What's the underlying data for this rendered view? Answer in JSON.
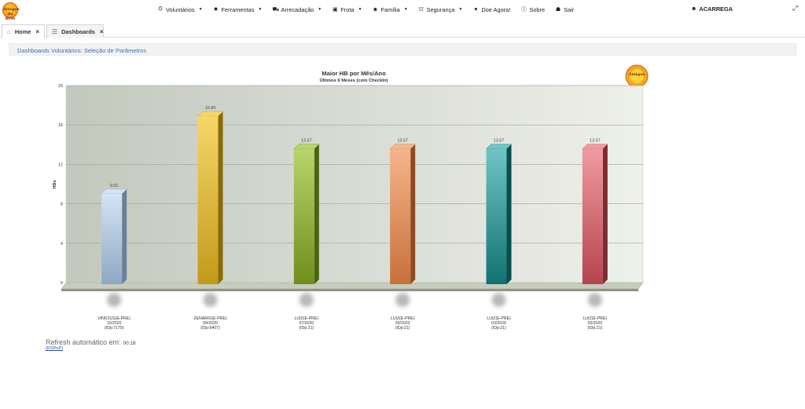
{
  "navbar": {
    "logo_text": "Amigos do Bem",
    "menu": [
      {
        "label": "Voluntários",
        "icon": "handshake-icon",
        "glyph": "⛭",
        "caret": true
      },
      {
        "label": "Ferramentas",
        "icon": "gear-icon",
        "glyph": "✹",
        "caret": true
      },
      {
        "label": "Arrecadação",
        "icon": "cart-icon",
        "glyph": "⛟",
        "caret": true
      },
      {
        "label": "Frota",
        "icon": "bus-icon",
        "glyph": "▣",
        "caret": true
      },
      {
        "label": "Família",
        "icon": "users-icon",
        "glyph": "☻",
        "caret": true
      },
      {
        "label": "Segurança",
        "icon": "lock-icon",
        "glyph": "⛫",
        "caret": true
      },
      {
        "label": "Doe Agora!",
        "icon": "heart-icon",
        "glyph": "♥",
        "caret": false
      },
      {
        "label": "Sobre",
        "icon": "info-icon",
        "glyph": "ⓘ",
        "caret": false
      },
      {
        "label": "Sair",
        "icon": "exit-icon",
        "glyph": "☗",
        "caret": false
      }
    ],
    "user": "ACARREGA"
  },
  "tabs": {
    "home": "Home",
    "dashboards": "Dashboards"
  },
  "breadcrumb": "Dashboards Voluntários: Seleção de Parâmetros",
  "chart_data": {
    "type": "bar",
    "title": "Maior HB por Mês/Ano",
    "subtitle": "Últimos 6 Meses (com CheckIn)",
    "ylabel": "HBs",
    "xlabel": "",
    "ylim": [
      0,
      20
    ],
    "yticks": [
      0,
      4,
      8,
      12,
      16,
      20
    ],
    "grid": true,
    "values": [
      9.01,
      16.89,
      13.57,
      13.57,
      13.57,
      13.57
    ],
    "value_labels": [
      "9.01",
      "16.89",
      "13.57",
      "13.57",
      "13.57",
      "13.57"
    ],
    "categories": [
      {
        "name": "VINICIUS(E-PRE)",
        "period": "10/2020",
        "id": "(IDp:7170)"
      },
      {
        "name": "ZENARIO(E-PRE)",
        "period": "09/2020",
        "id": "(IDp:6407)"
      },
      {
        "name": "LUIZ(E-PRE)",
        "period": "07/2020",
        "id": "(IDp:21)"
      },
      {
        "name": "LUIZ(E-PRE)",
        "period": "05/2020",
        "id": "(IDp:21)"
      },
      {
        "name": "LUIZ(E-PRE)",
        "period": "03/2020",
        "id": "(IDp:21)"
      },
      {
        "name": "LUIZ(E-PRE)",
        "period": "02/2020",
        "id": "(IDp:21)"
      }
    ],
    "colors": [
      [
        "#d4e4f5",
        "#8fa7c2",
        "#6a8099"
      ],
      [
        "#f6d66a",
        "#c29a1a",
        "#8a6a08"
      ],
      [
        "#b9d46a",
        "#6f8e1c",
        "#4a6410"
      ],
      [
        "#f4b58a",
        "#c7703a",
        "#8f4a22"
      ],
      [
        "#6fc4c4",
        "#127272",
        "#0a4d4d"
      ],
      [
        "#f09aa0",
        "#b4444e",
        "#7c2a32"
      ]
    ]
  },
  "refresh": {
    "label": "Refresh automático em:",
    "timer": "00:18",
    "link": "(RSPoP)"
  }
}
